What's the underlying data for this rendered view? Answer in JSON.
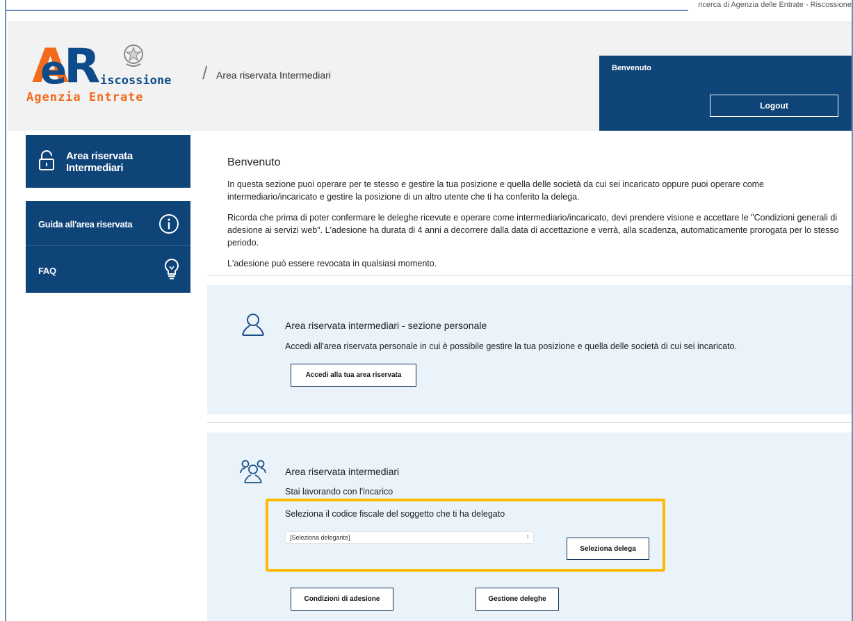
{
  "top_strip": {
    "text": "ricerca di Agenzia delle Entrate - Riscossione"
  },
  "header": {
    "logo": {
      "a": "A",
      "e": "e",
      "r": "R",
      "iscossione": "iscossione",
      "agenzia": "Agenzia Entrate"
    },
    "breadcrumb_separator": "/",
    "title": "Area riservata Intermediari",
    "welcome": "Benvenuto",
    "logout": "Logout"
  },
  "sidebar": {
    "card_label_line1": "Area riservata",
    "card_label_line2": "Intermediari",
    "items": [
      {
        "label": "Guida all'area riservata",
        "icon": "info-circle-icon"
      },
      {
        "label": "FAQ",
        "icon": "lightbulb-icon"
      }
    ]
  },
  "main": {
    "title": "Benvenuto",
    "paragraphs": [
      "In questa sezione puoi operare per te stesso e gestire la tua posizione e quella delle società da cui sei incaricato oppure puoi operare come intermediario/incaricato e gestire la posizione di un altro utente che ti ha conferito la delega.",
      "Ricorda che prima di poter confermare le deleghe ricevute e operare come intermediario/incaricato, devi prendere visione e accettare le \"Condizioni generali di adesione ai servizi web\". L'adesione ha durata di 4 anni a decorrere dalla data di accettazione e verrà, alla scadenza, automaticamente prorogata per lo stesso periodo.",
      "L'adesione può essere revocata in qualsiasi momento."
    ],
    "personal": {
      "title": "Area riservata intermediari - sezione personale",
      "text": "Accedi all'area riservata personale in cui è possibile gestire la tua posizione e quella delle società di cui sei incaricato.",
      "button": "Accedi alla tua area riservata"
    },
    "intermediari": {
      "title": "Area riservata intermediari",
      "working_with": "Stai lavorando con l'incarico",
      "select_label": "Seleziona il codice fiscale del soggetto che ti ha delegato",
      "select_value": "[Seleziona delegante]",
      "select_button": "Seleziona delega",
      "conditions_button": "Condizioni di adesione",
      "manage_button": "Gestione deleghe"
    }
  },
  "colors": {
    "brand_blue": "#0f4478",
    "brand_orange": "#f26a1b",
    "panel_bg": "#eaf2fa",
    "highlight": "#fbb900"
  }
}
